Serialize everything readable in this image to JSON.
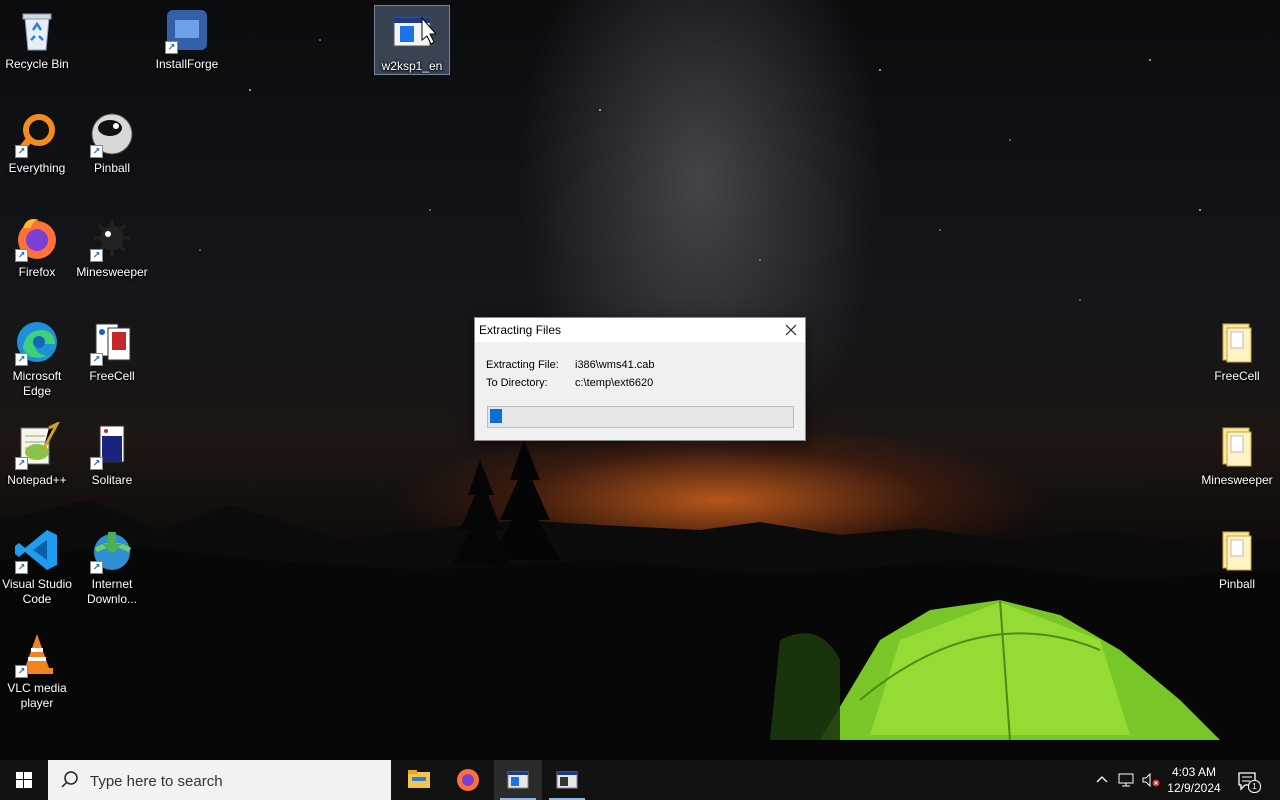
{
  "desktop": {
    "left_icons": [
      {
        "label": "Recycle Bin",
        "icon": "recycle-bin-icon"
      },
      {
        "label": "InstallForge",
        "icon": "installforge-icon"
      },
      {
        "label": "w2ksp1_en",
        "icon": "installer-window-icon"
      },
      {
        "label": "Everything",
        "icon": "magnifier-icon"
      },
      {
        "label": "Pinball",
        "icon": "pinball-icon"
      },
      {
        "label": "Firefox",
        "icon": "firefox-icon"
      },
      {
        "label": "Minesweeper",
        "icon": "mine-icon"
      },
      {
        "label": "Microsoft Edge",
        "icon": "edge-icon"
      },
      {
        "label": "FreeCell",
        "icon": "cards-icon"
      },
      {
        "label": "Notepad++",
        "icon": "notepadpp-icon"
      },
      {
        "label": "Solitare",
        "icon": "solitaire-icon"
      },
      {
        "label": "Visual Studio Code",
        "icon": "vscode-icon"
      },
      {
        "label": "Internet Downlo...",
        "icon": "idm-icon"
      },
      {
        "label": "VLC media player",
        "icon": "vlc-cone-icon"
      }
    ],
    "right_icons": [
      {
        "label": "FreeCell",
        "icon": "folder-icon"
      },
      {
        "label": "Minesweeper",
        "icon": "folder-icon"
      },
      {
        "label": "Pinball",
        "icon": "folder-icon"
      }
    ]
  },
  "dialog": {
    "title": "Extracting Files",
    "extracting_label": "Extracting File:",
    "extracting_value": "i386\\wms41.cab",
    "directory_label": "To Directory:",
    "directory_value": "c:\\temp\\ext6620",
    "progress": 0.04
  },
  "taskbar": {
    "search_placeholder": "Type here to search",
    "apps": [
      "file-explorer-icon",
      "firefox-icon",
      "installer-window-icon",
      "installer-window-icon"
    ],
    "time": "4:03 AM",
    "date": "12/9/2024",
    "notification_count": "1",
    "accent": "#0f6cd6"
  }
}
